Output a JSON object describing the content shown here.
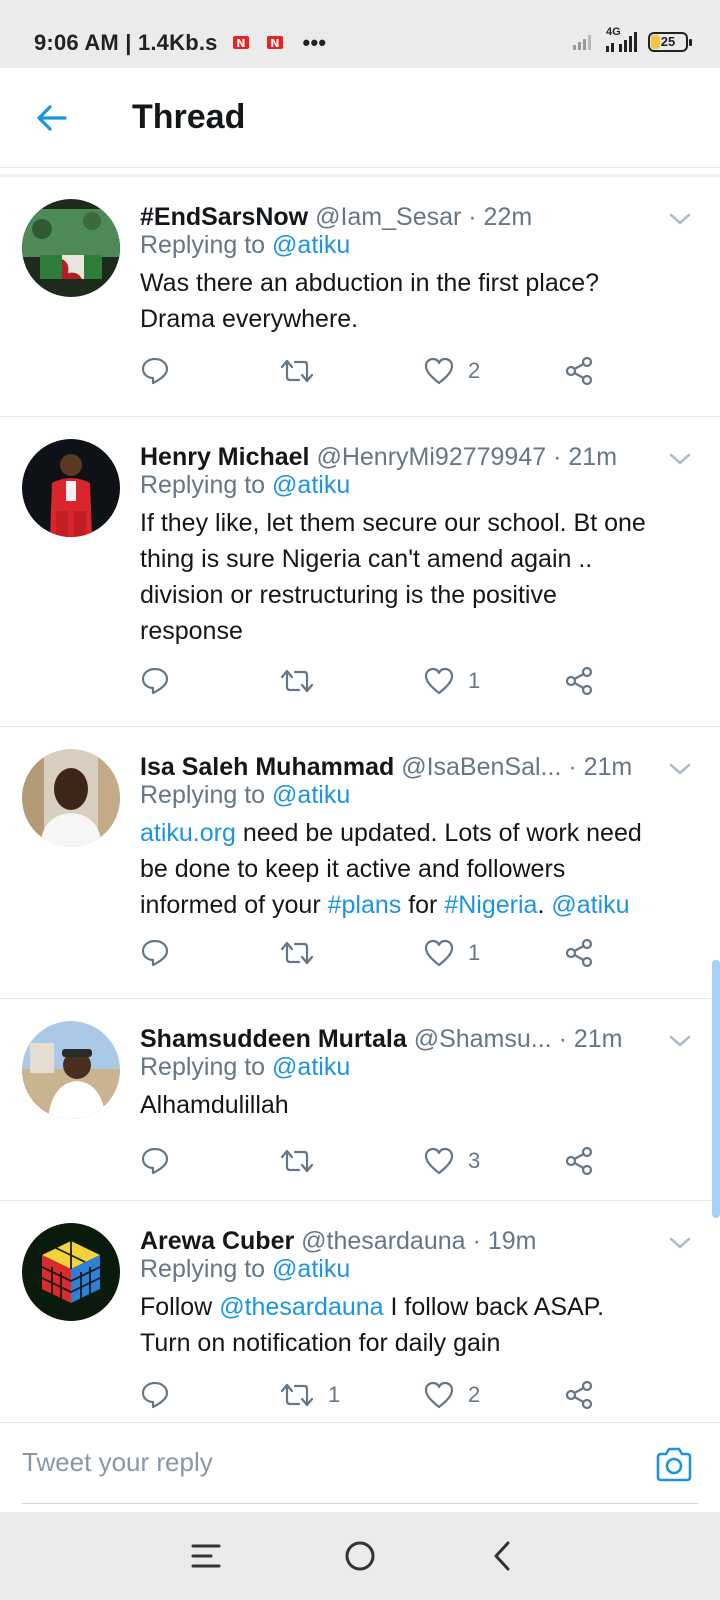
{
  "status_bar": {
    "time": "9:06 AM",
    "speed": "1.4Kb.s",
    "more": "•••",
    "network": "4G",
    "battery": "25",
    "battery_level": 0.25
  },
  "header": {
    "title": "Thread"
  },
  "tweets": [
    {
      "name": "#EndSarsNow",
      "handle": "@Iam_Sesar",
      "time": "· 22m",
      "replying_prefix": "Replying to",
      "replying_to": "@atiku",
      "text_lines": [
        "Was there an abduction in the first place?",
        "Drama everywhere."
      ],
      "retweets": "",
      "likes": "2"
    },
    {
      "name": "Henry Michael",
      "handle": "@HenryMi92779947",
      "time": "· 21m",
      "replying_prefix": "Replying to",
      "replying_to": "@atiku",
      "text_lines": [
        "If they like, let them secure our school. Bt one",
        "thing is sure Nigeria can't amend again ..",
        "division or restructuring is the positive",
        "response"
      ],
      "retweets": "",
      "likes": "1"
    },
    {
      "name": "Isa Saleh Muhammad",
      "handle": "@IsaBenSal...",
      "time": "· 21m",
      "replying_prefix": "Replying to",
      "replying_to": "@atiku",
      "text": {
        "link_site": "atiku.org",
        "part1": " need be updated. Lots of work need",
        "part2": "be done to keep it active and followers",
        "part3": "informed of your ",
        "tag_plans": "#plans",
        "part4": " for ",
        "tag_nigeria": "#Nigeria",
        "part5": ". ",
        "mention": "@atiku"
      },
      "retweets": "",
      "likes": "1"
    },
    {
      "name": "Shamsuddeen Murtala",
      "handle": "@Shamsu...",
      "time": "· 21m",
      "replying_prefix": "Replying to",
      "replying_to": "@atiku",
      "text_lines": [
        "Alhamdulillah"
      ],
      "retweets": "",
      "likes": "3"
    },
    {
      "name": "Arewa Cuber",
      "handle": "@thesardauna",
      "time": "· 19m",
      "replying_prefix": "Replying to",
      "replying_to": "@atiku",
      "text": {
        "part1": "Follow ",
        "mention": "@thesardauna",
        "part2": " I follow back ASAP.",
        "line2": "Turn on notification for daily gain"
      },
      "retweets": "1",
      "likes": "2"
    }
  ],
  "reply": {
    "placeholder": "Tweet your reply"
  },
  "colors": {
    "accent": "#1b95e0",
    "muted": "#657786",
    "text": "#14171a",
    "divider": "#e1e8ed"
  },
  "icons": [
    "back-arrow-icon",
    "chevron-down-icon",
    "reply-icon",
    "retweet-icon",
    "like-icon",
    "share-icon",
    "camera-icon",
    "menu-icon",
    "home-icon",
    "back-icon"
  ]
}
